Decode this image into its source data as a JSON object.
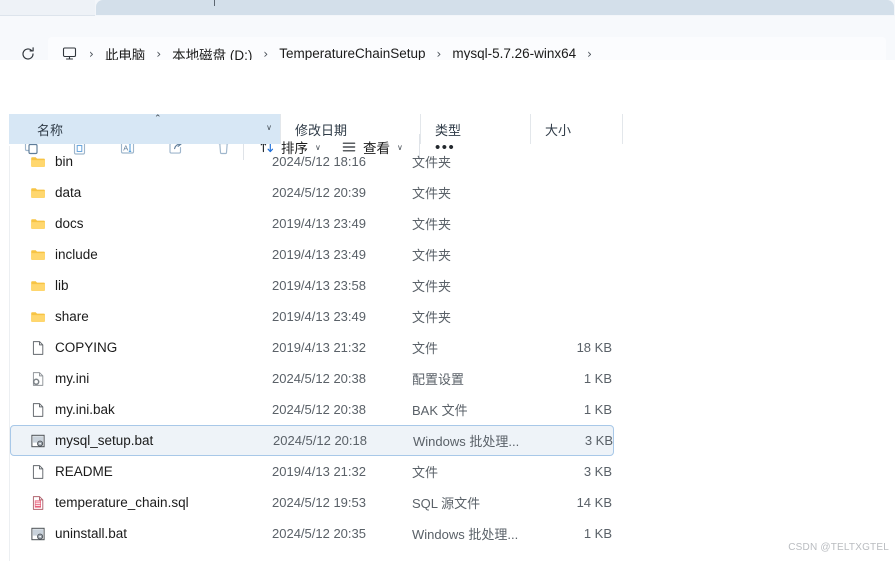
{
  "window": {
    "tab_label": ""
  },
  "addressbar": {
    "refresh_icon": "refresh-icon",
    "root_icon": "this-pc-monitor-icon",
    "separator": "›",
    "crumbs": [
      {
        "label": "此电脑"
      },
      {
        "label": "本地磁盘 (D:)"
      },
      {
        "label": "TemperatureChainSetup"
      },
      {
        "label": "mysql-5.7.26-winx64"
      }
    ]
  },
  "toolbar": {
    "buttons": [
      {
        "name": "copy-button",
        "icon": "copy-icon"
      },
      {
        "name": "paste-button",
        "icon": "paste-icon"
      },
      {
        "name": "rename-button",
        "icon": "rename-icon"
      },
      {
        "name": "share-button",
        "icon": "share-icon"
      },
      {
        "name": "delete-button",
        "icon": "trash-icon"
      }
    ],
    "sort_label": "排序",
    "view_label": "查看",
    "more_label": "•••",
    "chevron": "∨"
  },
  "columns": {
    "name": "名称",
    "date": "修改日期",
    "type": "类型",
    "size": "大小",
    "sort_direction_glyph": "⌃",
    "name_chevron": "∨"
  },
  "files": [
    {
      "name": "bin",
      "date": "2024/5/12 18:16",
      "type": "文件夹",
      "size": "",
      "icon": "folder-icon",
      "selected": false
    },
    {
      "name": "data",
      "date": "2024/5/12 20:39",
      "type": "文件夹",
      "size": "",
      "icon": "folder-icon",
      "selected": false
    },
    {
      "name": "docs",
      "date": "2019/4/13 23:49",
      "type": "文件夹",
      "size": "",
      "icon": "folder-icon",
      "selected": false
    },
    {
      "name": "include",
      "date": "2019/4/13 23:49",
      "type": "文件夹",
      "size": "",
      "icon": "folder-icon",
      "selected": false
    },
    {
      "name": "lib",
      "date": "2019/4/13 23:58",
      "type": "文件夹",
      "size": "",
      "icon": "folder-icon",
      "selected": false
    },
    {
      "name": "share",
      "date": "2019/4/13 23:49",
      "type": "文件夹",
      "size": "",
      "icon": "folder-icon",
      "selected": false
    },
    {
      "name": "COPYING",
      "date": "2019/4/13 21:32",
      "type": "文件",
      "size": "18 KB",
      "icon": "generic-file-icon",
      "selected": false
    },
    {
      "name": "my.ini",
      "date": "2024/5/12 20:38",
      "type": "配置设置",
      "size": "1 KB",
      "icon": "config-file-icon",
      "selected": false
    },
    {
      "name": "my.ini.bak",
      "date": "2024/5/12 20:38",
      "type": "BAK 文件",
      "size": "1 KB",
      "icon": "generic-file-icon",
      "selected": false
    },
    {
      "name": "mysql_setup.bat",
      "date": "2024/5/12 20:18",
      "type": "Windows 批处理...",
      "size": "3 KB",
      "icon": "batch-file-icon",
      "selected": true
    },
    {
      "name": "README",
      "date": "2019/4/13 21:32",
      "type": "文件",
      "size": "3 KB",
      "icon": "generic-file-icon",
      "selected": false
    },
    {
      "name": "temperature_chain.sql",
      "date": "2024/5/12 19:53",
      "type": "SQL 源文件",
      "size": "14 KB",
      "icon": "sql-file-icon",
      "selected": false
    },
    {
      "name": "uninstall.bat",
      "date": "2024/5/12 20:35",
      "type": "Windows 批处理...",
      "size": "1 KB",
      "icon": "batch-file-icon",
      "selected": false
    }
  ],
  "watermark": {
    "text": "CSDN @TELTXGTEL"
  },
  "colors": {
    "folder": "#f7c444",
    "selection_bg": "#eef3f8",
    "selection_border": "#a8c8e8",
    "sorted_column_bg": "#d7e7f5",
    "accent_blue": "#1e6fd9",
    "sql_red": "#e8607a"
  }
}
